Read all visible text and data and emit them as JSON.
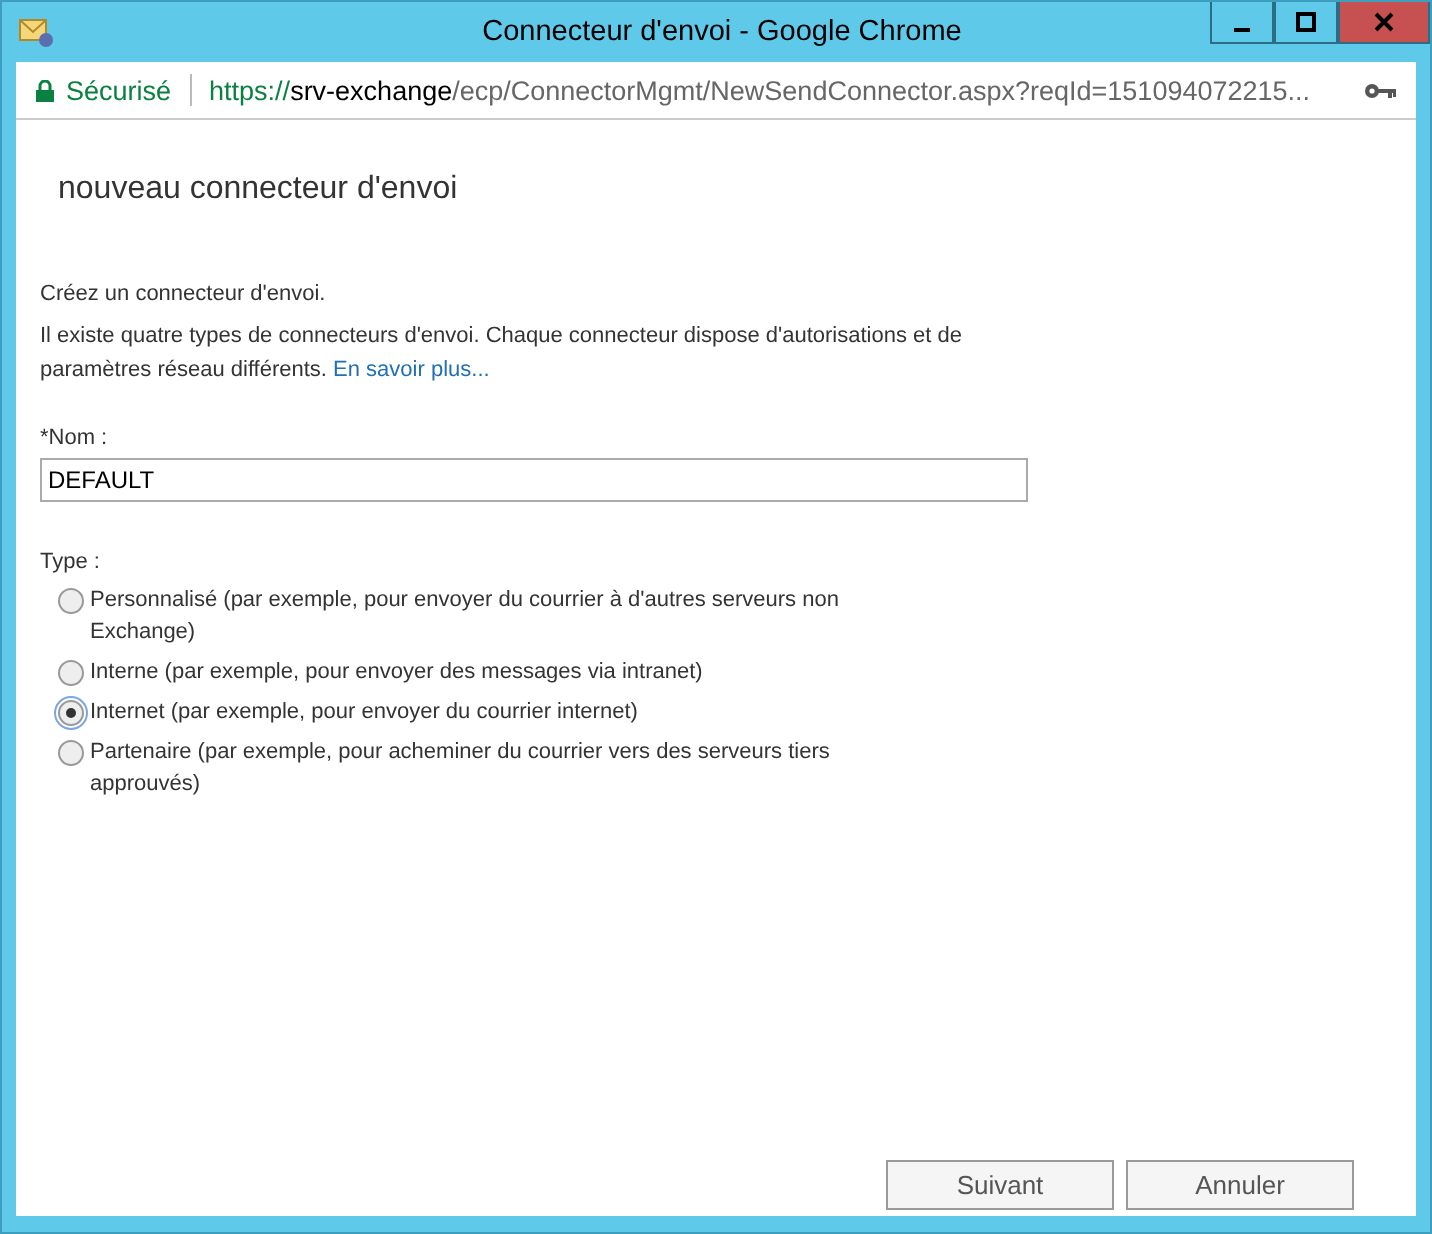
{
  "window": {
    "title": "Connecteur d'envoi - Google Chrome"
  },
  "address_bar": {
    "security": "Sécurisé",
    "url_scheme": "https://",
    "url_host": "srv-exchange",
    "url_path": "/ecp/ConnectorMgmt/NewSendConnector.aspx?reqId=151094072215..."
  },
  "page": {
    "heading": "nouveau connecteur d'envoi",
    "intro": "Créez un connecteur d'envoi.",
    "description": "Il existe quatre types de connecteurs d'envoi. Chaque connecteur dispose d'autorisations et de paramètres réseau différents.",
    "link": "En savoir plus..."
  },
  "name_field": {
    "label": "*Nom :",
    "value": "DEFAULT"
  },
  "type_group": {
    "label": "Type :",
    "options": [
      {
        "label": "Personnalisé (par exemple, pour envoyer du courrier à d'autres serveurs non Exchange)",
        "selected": false
      },
      {
        "label": "Interne (par exemple, pour envoyer des messages via intranet)",
        "selected": false
      },
      {
        "label": "Internet (par exemple, pour envoyer du courrier internet)",
        "selected": true
      },
      {
        "label": "Partenaire (par exemple, pour acheminer du courrier vers des serveurs tiers approuvés)",
        "selected": false
      }
    ]
  },
  "buttons": [
    "Suivant",
    "Annuler"
  ]
}
